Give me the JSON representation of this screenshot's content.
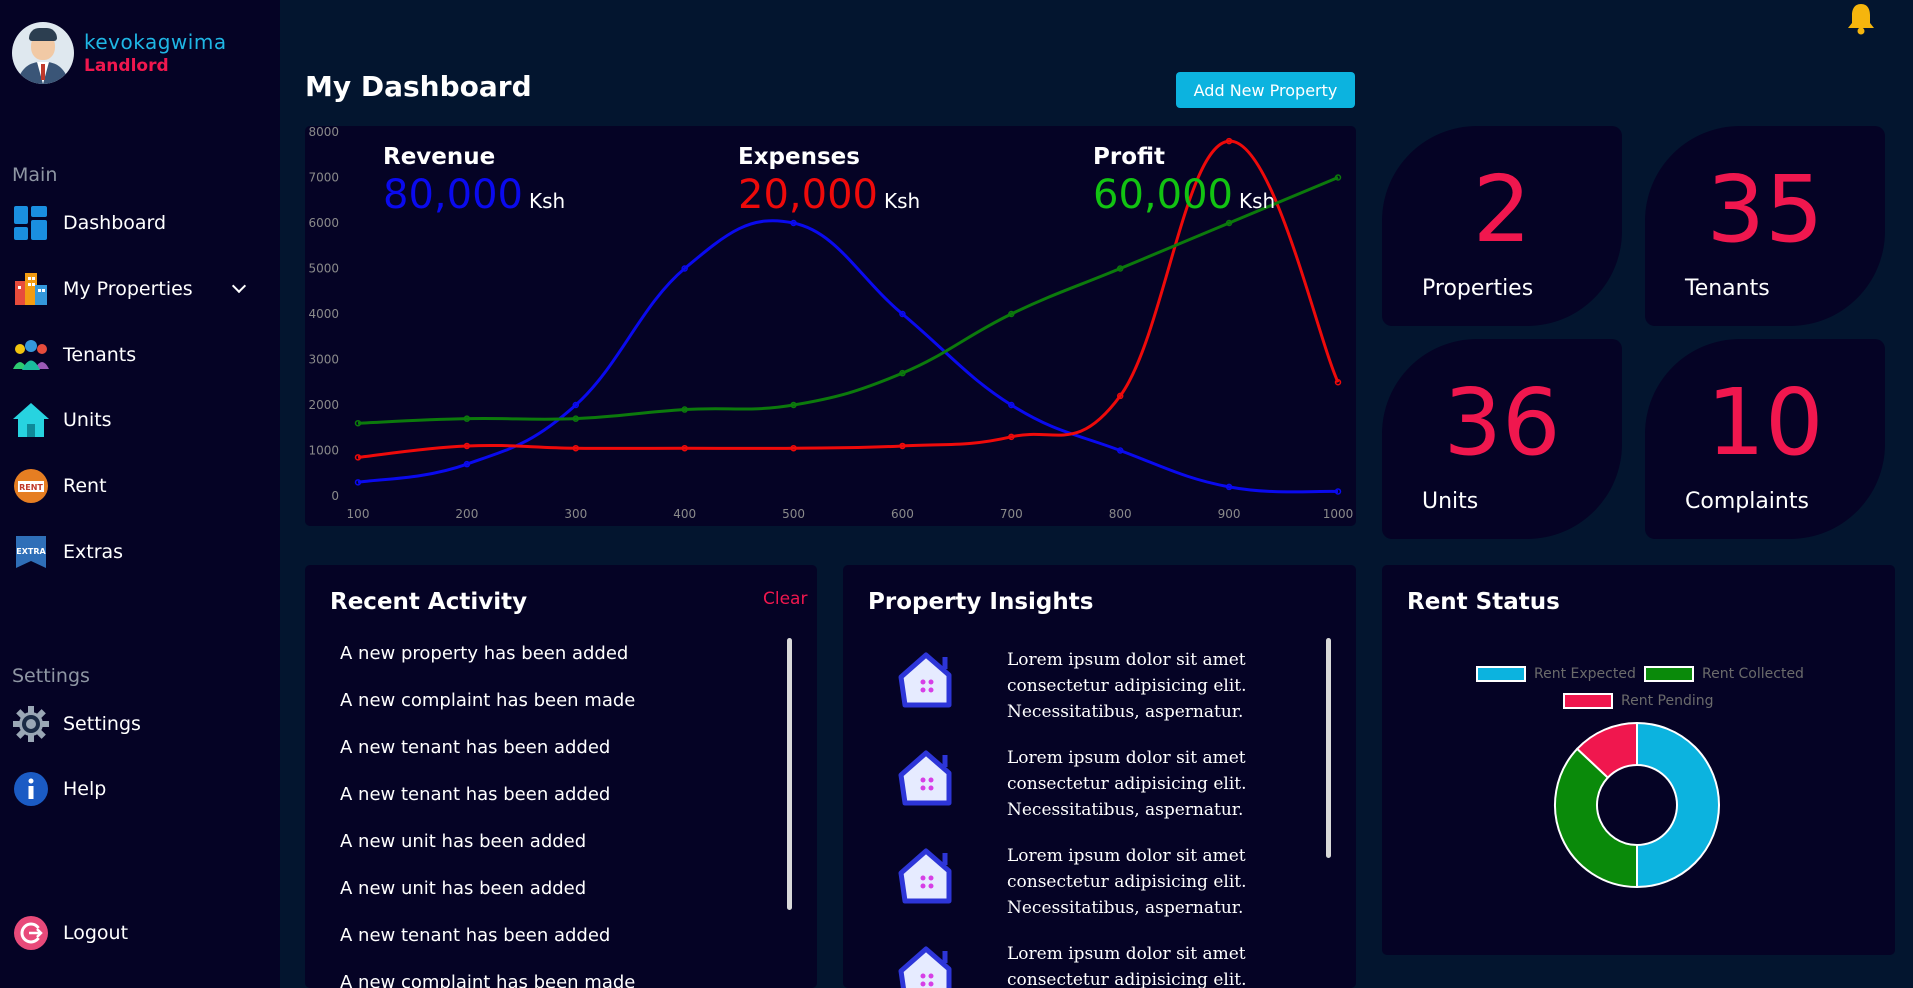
{
  "user": {
    "name": "kevokagwima",
    "role": "Landlord"
  },
  "nav": {
    "main_label": "Main",
    "settings_label": "Settings",
    "items": [
      {
        "label": "Dashboard",
        "icon": "dashboard-grid-icon"
      },
      {
        "label": "My Properties",
        "icon": "buildings-icon"
      },
      {
        "label": "Tenants",
        "icon": "people-icon"
      },
      {
        "label": "Units",
        "icon": "house-icon"
      },
      {
        "label": "Rent",
        "icon": "rent-sign-icon"
      },
      {
        "label": "Extras",
        "icon": "extra-banner-icon"
      }
    ],
    "settings_items": [
      {
        "label": "Settings",
        "icon": "gear-icon"
      },
      {
        "label": "Help",
        "icon": "info-icon"
      }
    ],
    "logout": "Logout"
  },
  "header": {
    "title": "My Dashboard",
    "add_button": "Add New Property"
  },
  "stats": {
    "revenue": {
      "title": "Revenue",
      "value": "80,000",
      "unit": "Ksh",
      "color": "#0a0aee"
    },
    "expenses": {
      "title": "Expenses",
      "value": "20,000",
      "unit": "Ksh",
      "color": "#ee0a0a"
    },
    "profit": {
      "title": "Profit",
      "value": "60,000",
      "unit": "Ksh",
      "color": "#12c312"
    }
  },
  "kpis": [
    {
      "value": "2",
      "label": "Properties"
    },
    {
      "value": "35",
      "label": "Tenants"
    },
    {
      "value": "36",
      "label": "Units"
    },
    {
      "value": "10",
      "label": "Complaints"
    }
  ],
  "recent_activity": {
    "title": "Recent Activity",
    "clear": "Clear",
    "items": [
      "A new property has been added",
      "A new complaint has been made",
      "A new tenant has been added",
      "A new tenant has been added",
      "A new unit has been added",
      "A new unit has been added",
      "A new tenant has been added",
      "A new complaint has been made"
    ]
  },
  "insights": {
    "title": "Property Insights",
    "items": [
      "Lorem ipsum dolor sit amet consectetur adipisicing elit. Necessitatibus, aspernatur.",
      "Lorem ipsum dolor sit amet consectetur adipisicing elit. Necessitatibus, aspernatur.",
      "Lorem ipsum dolor sit amet consectetur adipisicing elit. Necessitatibus, aspernatur.",
      "Lorem ipsum dolor sit amet consectetur adipisicing elit."
    ]
  },
  "rent_status": {
    "title": "Rent Status"
  },
  "chart_data": [
    {
      "type": "line",
      "x": [
        100,
        200,
        300,
        400,
        500,
        600,
        700,
        800,
        900,
        1000
      ],
      "xlim": [
        100,
        1000
      ],
      "ylim": [
        0,
        8000
      ],
      "yticks": [
        0,
        1000,
        2000,
        3000,
        4000,
        5000,
        6000,
        7000,
        8000
      ],
      "xticks": [
        100,
        200,
        300,
        400,
        500,
        600,
        700,
        800,
        900,
        1000
      ],
      "grid": false,
      "series": [
        {
          "name": "Revenue",
          "color": "#0a0aee",
          "values": [
            300,
            700,
            2000,
            5000,
            6000,
            4000,
            2000,
            1000,
            200,
            100
          ]
        },
        {
          "name": "Expenses",
          "color": "#ee0a0a",
          "values": [
            850,
            1100,
            1050,
            1050,
            1050,
            1100,
            1300,
            2200,
            7800,
            2500
          ]
        },
        {
          "name": "Profit",
          "color": "#0c7a0c",
          "values": [
            1600,
            1700,
            1700,
            1900,
            2000,
            2700,
            4000,
            5000,
            6000,
            7000
          ]
        }
      ]
    },
    {
      "type": "pie",
      "title": "Rent Status",
      "labels": [
        "Rent Expected",
        "Rent Collected",
        "Rent Pending"
      ],
      "values": [
        50,
        37,
        13
      ],
      "colors": [
        "#0cb3df",
        "#0a8a0a",
        "#f0174e"
      ],
      "legend": "top",
      "donut": true
    }
  ]
}
